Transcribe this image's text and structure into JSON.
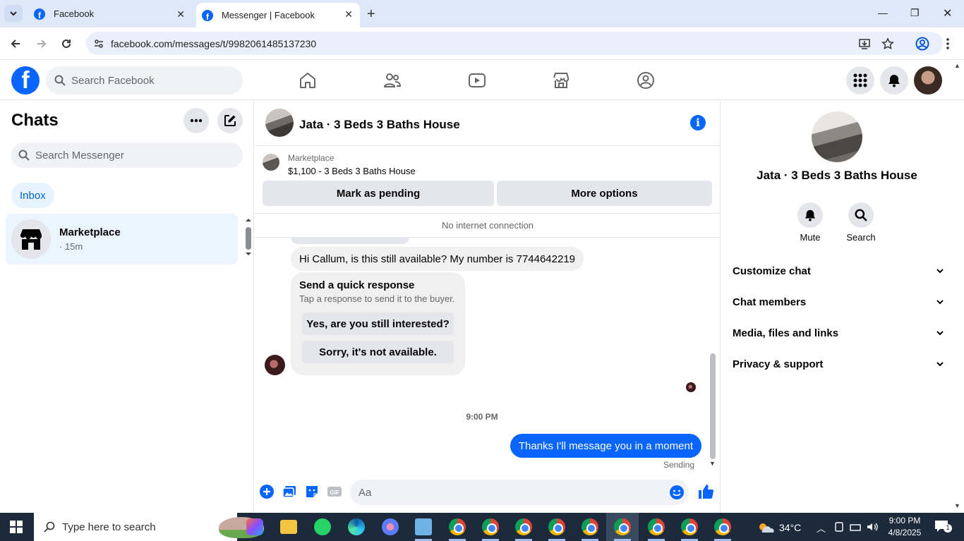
{
  "browser": {
    "tabs": [
      {
        "title": "Facebook",
        "active": false
      },
      {
        "title": "Messenger | Facebook",
        "active": true
      }
    ],
    "url": "facebook.com/messages/t/9982061485137230"
  },
  "fb_header": {
    "search_placeholder": "Search Facebook",
    "nav_icons": [
      "home-icon",
      "friends-icon",
      "video-icon",
      "marketplace-icon",
      "groups-icon"
    ],
    "right_icons": [
      "menu-grid-icon",
      "notifications-bell-icon",
      "profile-avatar"
    ]
  },
  "chats_panel": {
    "title": "Chats",
    "search_placeholder": "Search Messenger",
    "filter": "Inbox",
    "items": [
      {
        "name": "Marketplace",
        "time": "· 15m"
      }
    ]
  },
  "conversation": {
    "title": "Jata · 3 Beds 3 Baths House",
    "marketplace": {
      "label": "Marketplace",
      "listing": "$1,100 - 3 Beds 3 Baths House",
      "buttons": [
        "Mark as pending",
        "More options"
      ]
    },
    "status_banner": "No internet connection",
    "messages": [
      {
        "from": "other",
        "text": "Hi Callum, is this still available? My number is 7744642219"
      }
    ],
    "quick_response": {
      "title": "Send a quick response",
      "subtitle": "Tap a response to send it to the buyer.",
      "options": [
        "Yes, are you still interested?",
        "Sorry, it's not available."
      ]
    },
    "timestamp": "9:00 PM",
    "outgoing": {
      "text": "Thanks I'll message you in a moment",
      "status": "Sending"
    },
    "composer_placeholder": "Aa"
  },
  "info_panel": {
    "title": "Jata · 3 Beds 3 Baths House",
    "actions": [
      {
        "label": "Mute",
        "icon": "bell-icon"
      },
      {
        "label": "Search",
        "icon": "search-icon"
      }
    ],
    "sections": [
      "Customize chat",
      "Chat members",
      "Media, files and links",
      "Privacy & support"
    ]
  },
  "taskbar": {
    "search_placeholder": "Type here to search",
    "temperature": "34°C",
    "time": "9:00 PM",
    "date": "4/8/2025",
    "notification_count": "1"
  },
  "colors": {
    "fb_blue": "#0866ff",
    "taskbar": "#1c2a3b",
    "chrome_tabbar": "#dee8f9"
  }
}
